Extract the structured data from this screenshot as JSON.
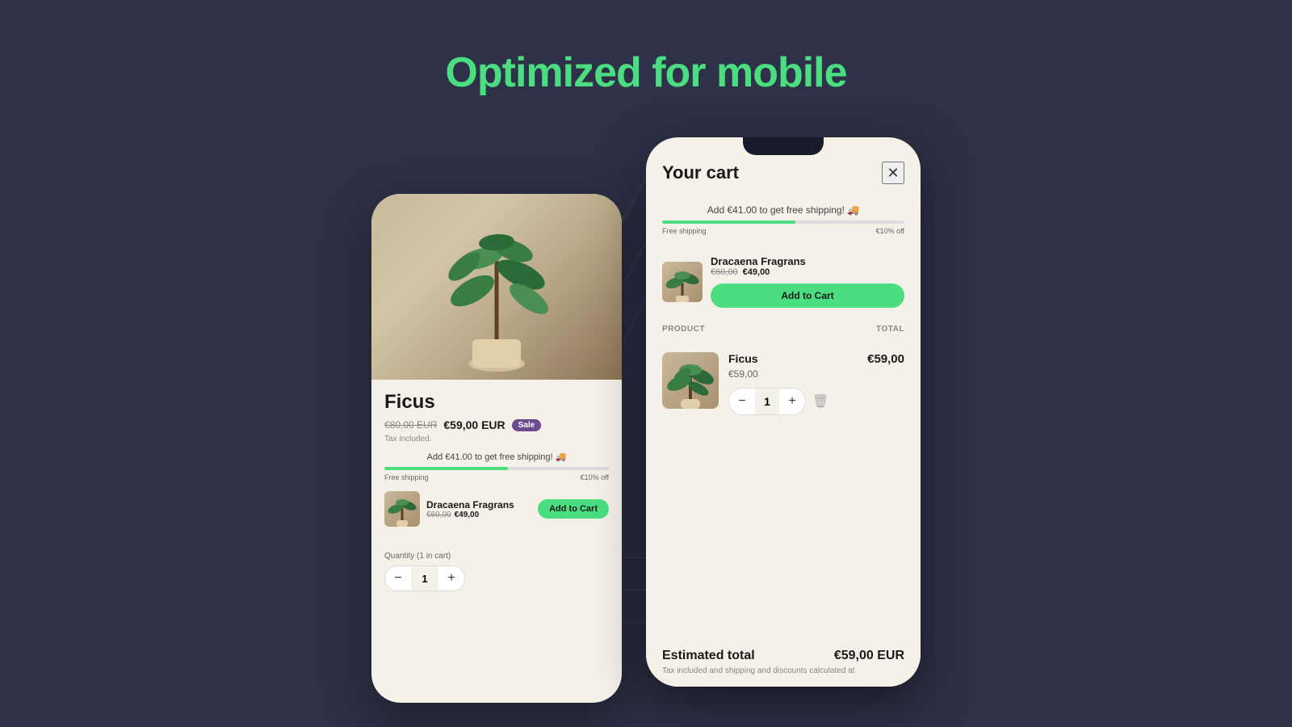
{
  "page": {
    "title": "Optimized for mobile",
    "background": "#2e3147"
  },
  "left_phone": {
    "product_name": "Ficus",
    "original_price": "€80,00 EUR",
    "sale_price": "€59,00 EUR",
    "sale_badge": "Sale",
    "tax_note": "Tax included.",
    "shipping_promo": "Add €41.00 to get free shipping! 🚚",
    "progress_label_left": "Free shipping",
    "progress_label_right": "€10% off",
    "upsell_name": "Dracaena Fragrans",
    "upsell_original": "€60,00",
    "upsell_sale": "€49,00",
    "add_to_cart": "Add to Cart",
    "quantity_label": "Quantity (1 in cart)",
    "quantity_value": "1"
  },
  "right_phone": {
    "cart_title": "Your cart",
    "shipping_promo": "Add €41.00 to get free shipping! 🚚",
    "progress_label_left": "Free shipping",
    "progress_label_right": "€10% off",
    "upsell_name": "Dracaena Fragrans",
    "upsell_original": "€60,00",
    "upsell_sale": "€49,00",
    "add_to_cart": "Add to Cart",
    "col_product": "PRODUCT",
    "col_total": "TOTAL",
    "item_name": "Ficus",
    "item_price": "€59,00",
    "item_total": "€59,00",
    "item_qty": "1",
    "estimated_label": "Estimated total",
    "estimated_total": "€59,00 EUR",
    "estimated_note": "Tax included and shipping and discounts calculated at"
  }
}
